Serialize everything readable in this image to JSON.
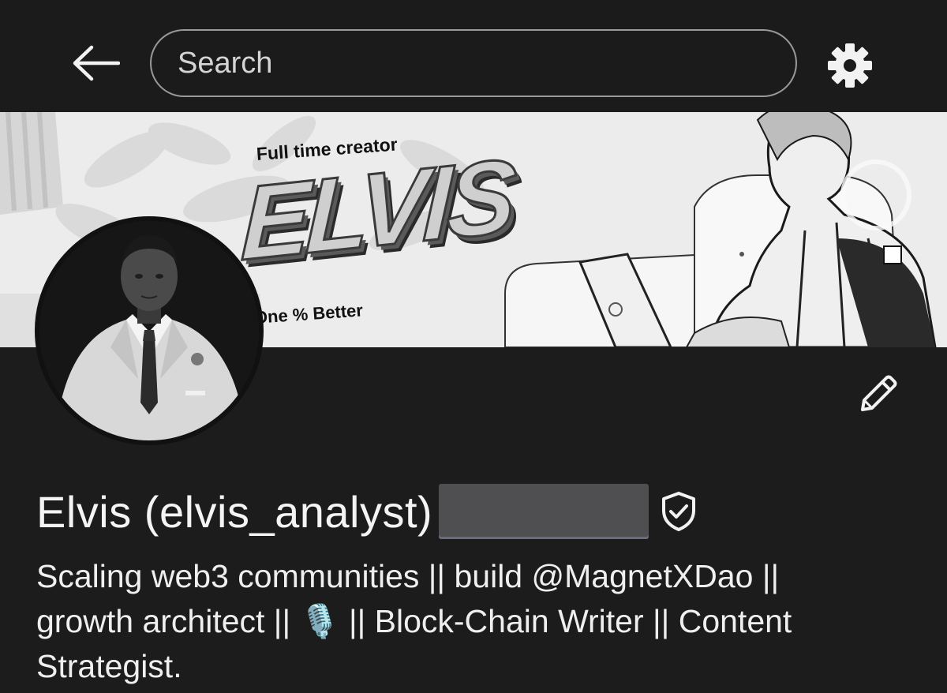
{
  "header": {
    "search": {
      "placeholder": "Search",
      "value": ""
    }
  },
  "banner": {
    "subtitle": "Full time creator",
    "name": "ELVIS",
    "tagline": "One % Better"
  },
  "profile": {
    "name": "Elvis (elvis_analyst)",
    "bio_line1": "Scaling web3 communities || build @MagnetXDao ||",
    "bio_line2_a": "growth architect || ",
    "bio_line2_emoji": "🎙️",
    "bio_line2_b": " || Block-Chain Writer || Content",
    "bio_line3": "Strategist."
  },
  "icons": {
    "back": "arrow-left-icon",
    "settings": "gear-icon",
    "edit": "pencil-icon",
    "verified": "shield-check-icon"
  },
  "colors": {
    "background": "#1c1c1c",
    "text": "#f2f2f2",
    "search_border": "#9a9a9a",
    "redaction": "#4f4f51"
  }
}
